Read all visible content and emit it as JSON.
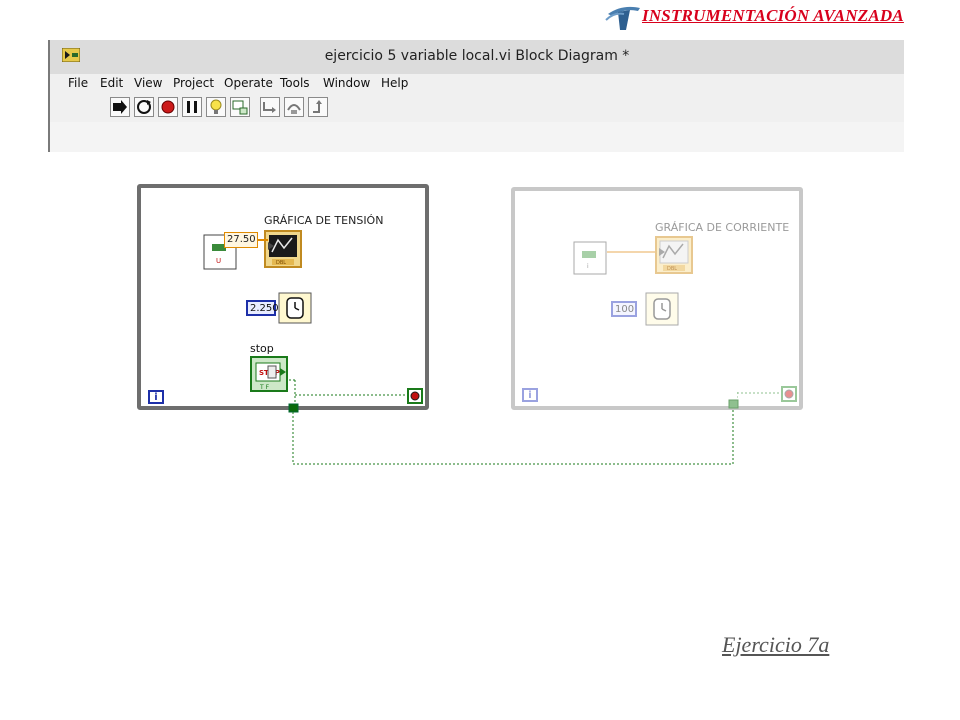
{
  "header": {
    "brand": "INSTRUMENTACIÓN AVANZADA"
  },
  "window": {
    "title": "ejercicio 5 variable local.vi Block Diagram *",
    "menu": [
      "File",
      "Edit",
      "View",
      "Project",
      "Operate",
      "Tools",
      "Window",
      "Help"
    ],
    "toolbar": [
      "run-arrow-icon",
      "run-continuously-icon",
      "abort-icon",
      "pause-icon",
      "highlight-execution-icon",
      "retain-wire-values-icon",
      "step-into-icon",
      "step-over-icon",
      "step-out-icon"
    ]
  },
  "diagram": {
    "loop1": {
      "graph_label": "GRÁFICA DE TENSIÓN",
      "value": "27.50",
      "wait_const": "2.250",
      "stop_label": "stop",
      "iteration": "i"
    },
    "loop2": {
      "graph_label": "GRÁFICA DE CORRIENTE",
      "wait_const": "100",
      "iteration": "i"
    }
  },
  "caption": "Ejercicio 7a"
}
